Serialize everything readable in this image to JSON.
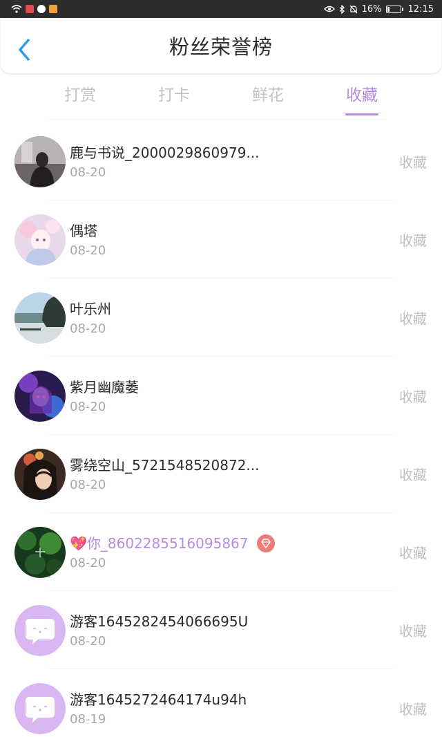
{
  "status": {
    "battery": "16%",
    "time": "12:15",
    "battery_level": 0.16
  },
  "header": {
    "title": "粉丝荣誉榜",
    "back_icon": "chevron-left-icon"
  },
  "tabs": [
    {
      "label": "打赏",
      "active": false
    },
    {
      "label": "打卡",
      "active": false
    },
    {
      "label": "鲜花",
      "active": false
    },
    {
      "label": "收藏",
      "active": true
    }
  ],
  "colors": {
    "accent": "#b58ce0",
    "muted": "#c0c0c0",
    "vip_badge": "#f07b7b"
  },
  "items": [
    {
      "name": "鹿与书说_2000029860979...",
      "date": "08-20",
      "action": "收藏",
      "avatar": "photo-dark-figure"
    },
    {
      "name": "偶塔",
      "date": "08-20",
      "action": "收藏",
      "avatar": "anime-girl-pastel"
    },
    {
      "name": "叶乐州",
      "date": "08-20",
      "action": "收藏",
      "avatar": "lake-landscape"
    },
    {
      "name": "紫月幽魔萎",
      "date": "08-20",
      "action": "收藏",
      "avatar": "anime-purple"
    },
    {
      "name": "雾绕空山_5721548520872...",
      "date": "08-20",
      "action": "收藏",
      "avatar": "painted-lady"
    },
    {
      "name": "你_8602285516095867",
      "date": "08-20",
      "action": "收藏",
      "avatar": "green-ink",
      "heart_icon": "sparkle-heart-icon",
      "badge_icon": "diamond-icon"
    },
    {
      "name": "游客1645282454066695U",
      "date": "08-20",
      "action": "收藏",
      "avatar": "default-chat-bubble"
    },
    {
      "name": "游客1645272464174u94h",
      "date": "08-19",
      "action": "收藏",
      "avatar": "default-chat-bubble"
    }
  ]
}
